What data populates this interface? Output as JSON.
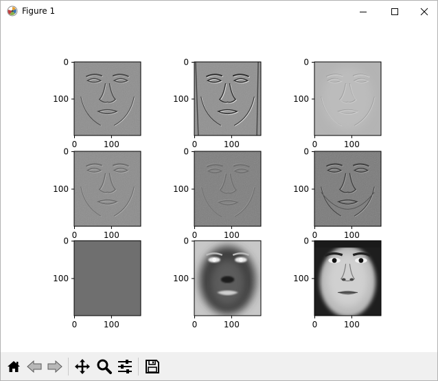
{
  "window": {
    "title": "Figure 1"
  },
  "figure": {
    "grid": "3x3",
    "subplots": [
      {
        "yticks": [
          "0",
          "100"
        ],
        "xticks": [
          "0",
          "100"
        ],
        "style": "eigenface-1"
      },
      {
        "yticks": [
          "0",
          "100"
        ],
        "xticks": [
          "0",
          "100"
        ],
        "style": "eigenface-2"
      },
      {
        "yticks": [
          "0",
          "100"
        ],
        "xticks": [
          "0",
          "100"
        ],
        "style": "eigenface-3"
      },
      {
        "yticks": [
          "0",
          "100"
        ],
        "xticks": [
          "0",
          "100"
        ],
        "style": "eigenface-4"
      },
      {
        "yticks": [
          "0",
          "100"
        ],
        "xticks": [
          "0",
          "100"
        ],
        "style": "eigenface-5"
      },
      {
        "yticks": [
          "0",
          "100"
        ],
        "xticks": [
          "0",
          "100"
        ],
        "style": "eigenface-6"
      },
      {
        "yticks": [
          "0",
          "100"
        ],
        "xticks": [
          "0",
          "100"
        ],
        "style": "flat-gray"
      },
      {
        "yticks": [
          "0",
          "100"
        ],
        "xticks": [
          "0",
          "100"
        ],
        "style": "negative-face"
      },
      {
        "yticks": [
          "0",
          "100"
        ],
        "xticks": [
          "0",
          "100"
        ],
        "style": "original-face"
      }
    ]
  },
  "toolbar": {
    "buttons": [
      {
        "name": "home-button",
        "icon": "home-icon"
      },
      {
        "name": "back-button",
        "icon": "arrow-left-icon"
      },
      {
        "name": "forward-button",
        "icon": "arrow-right-icon"
      },
      {
        "name": "pan-button",
        "icon": "move-icon"
      },
      {
        "name": "zoom-button",
        "icon": "magnifier-icon"
      },
      {
        "name": "configure-subplots-button",
        "icon": "sliders-icon"
      },
      {
        "name": "save-button",
        "icon": "floppy-disk-icon"
      }
    ]
  }
}
